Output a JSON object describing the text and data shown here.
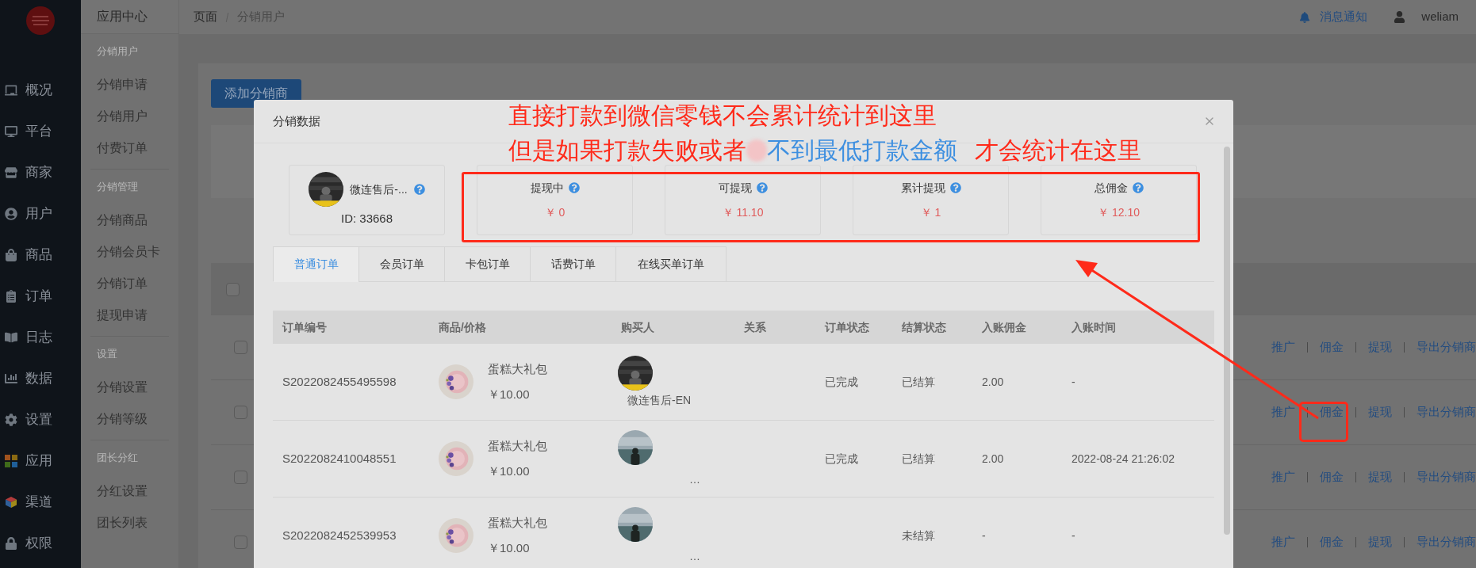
{
  "nav": [
    {
      "label": "概况"
    },
    {
      "label": "平台"
    },
    {
      "label": "商家"
    },
    {
      "label": "用户"
    },
    {
      "label": "商品"
    },
    {
      "label": "订单"
    },
    {
      "label": "日志"
    },
    {
      "label": "数据"
    },
    {
      "label": "设置"
    },
    {
      "label": "应用"
    },
    {
      "label": "渠道"
    },
    {
      "label": "权限"
    }
  ],
  "subnav": {
    "title": "应用中心",
    "groups": [
      {
        "heading": "分销用户",
        "items": [
          "分销申请",
          "分销用户",
          "付费订单"
        ]
      },
      {
        "heading": "分销管理",
        "items": [
          "分销商品",
          "分销会员卡",
          "分销订单",
          "提现申请"
        ]
      },
      {
        "heading": "设置",
        "items": [
          "分销设置",
          "分销等级"
        ]
      },
      {
        "heading": "团长分红",
        "items": [
          "分红设置",
          "团长列表"
        ]
      }
    ]
  },
  "breadcrumb": [
    "页面",
    "分销用户"
  ],
  "header": {
    "notifications": "消息通知",
    "user": "weliam"
  },
  "add_button": "添加分销商",
  "background_table": {
    "header_checked": false,
    "rows": [
      {
        "checked": false,
        "links": [
          "推广",
          "佣金",
          "提现",
          "导出分销商"
        ]
      },
      {
        "checked": false,
        "links": [
          "推广",
          "佣金",
          "提现",
          "导出分销商"
        ]
      },
      {
        "checked": false,
        "links": [
          "推广",
          "佣金",
          "提现",
          "导出分销商"
        ]
      },
      {
        "checked": false,
        "links": [
          "推广",
          "佣金",
          "提现",
          "导出分销商"
        ]
      }
    ]
  },
  "modal": {
    "title": "分销数据",
    "user": {
      "name": "微连售后-...",
      "id": "ID: 33668"
    },
    "stats": [
      {
        "label": "提现中",
        "value": "￥ 0"
      },
      {
        "label": "可提现",
        "value": "￥ 11.10"
      },
      {
        "label": "累计提现",
        "value": "￥ 1"
      },
      {
        "label": "总佣金",
        "value": "￥ 12.10"
      }
    ],
    "tabs": [
      {
        "label": "普通订单",
        "selected": true
      },
      {
        "label": "会员订单",
        "selected": false
      },
      {
        "label": "卡包订单",
        "selected": false
      },
      {
        "label": "话费订单",
        "selected": false
      },
      {
        "label": "在线买单订单",
        "selected": false
      }
    ],
    "table": {
      "columns": [
        "订单编号",
        "商品/价格",
        "购买人",
        "关系",
        "订单状态",
        "结算状态",
        "入账佣金",
        "入账时间"
      ],
      "rows": [
        {
          "order_no": "S2022082455495598",
          "product": "蛋糕大礼包",
          "price": "￥10.00",
          "buyer": "微连售后-EN",
          "order_status": "已完成",
          "settle_status": "已结算",
          "commission": "2.00",
          "time": "-"
        },
        {
          "order_no": "S2022082410048551",
          "product": "蛋糕大礼包",
          "price": "￥10.00",
          "buyer": "…",
          "order_status": "已完成",
          "settle_status": "已结算",
          "commission": "2.00",
          "time": "2022-08-24 21:26:02"
        },
        {
          "order_no": "S2022082452539953",
          "product": "蛋糕大礼包",
          "price": "￥10.00",
          "buyer": "…",
          "settle_status": "未结算",
          "commission": "-",
          "time": "-"
        }
      ]
    }
  },
  "annotation": {
    "lines": [
      [
        {
          "text": "直接打款到微信零钱不会累计统计到这里",
          "color": "#ff2a1a"
        }
      ],
      [
        {
          "text": "但是如果打款失败或者",
          "color": "#ff2a1a"
        },
        {
          "text": "不到最低打款金额",
          "color": "#3d8fe0"
        },
        {
          "text": "才会统计在这里",
          "color": "#ff2a1a"
        }
      ]
    ]
  }
}
